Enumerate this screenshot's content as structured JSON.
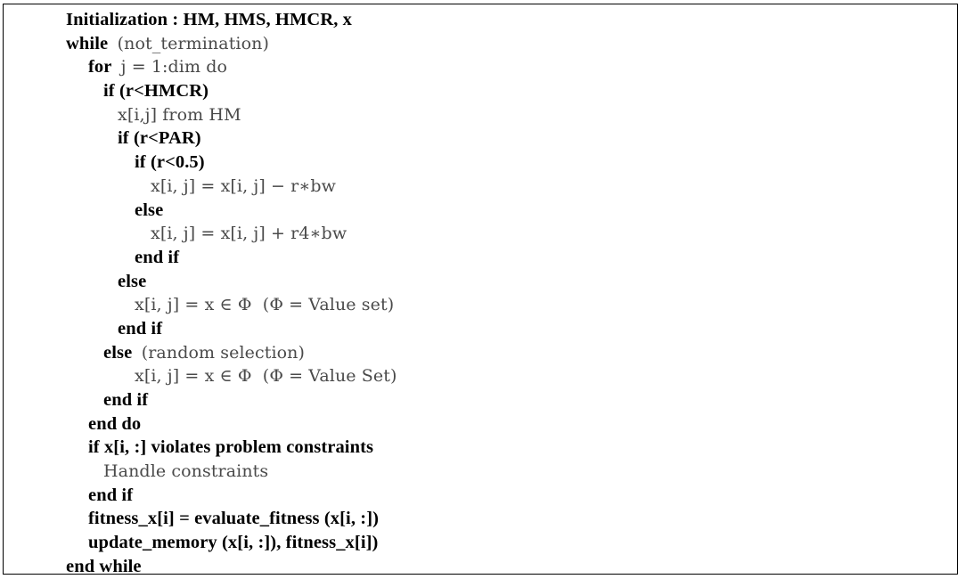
{
  "figure": {
    "kind": "pseudocode-listing",
    "border_color": "#000000",
    "background_color": "#ffffff",
    "text_color": "#000000",
    "light_text_color": "#4a4a4a",
    "line_count": 24
  },
  "code": {
    "lines": [
      {
        "indent": 0,
        "segments": [
          {
            "text": "Initialization : HM, HMS, HMCR, x",
            "weight": "strong"
          }
        ]
      },
      {
        "indent": 0,
        "segments": [
          {
            "text": "while  ",
            "weight": "strong"
          },
          {
            "text": "(not_termination)",
            "weight": "light"
          }
        ]
      },
      {
        "indent": 1,
        "segments": [
          {
            "text": "for  ",
            "weight": "strong"
          },
          {
            "text": "j = 1:dim do",
            "weight": "light"
          }
        ]
      },
      {
        "indent": 2,
        "segments": [
          {
            "text": "if (r<HMCR)",
            "weight": "strong"
          }
        ]
      },
      {
        "indent": 3,
        "segments": [
          {
            "text": "x[i,j] from HM",
            "weight": "light"
          }
        ]
      },
      {
        "indent": 3,
        "segments": [
          {
            "text": "if (r<PAR)",
            "weight": "strong"
          }
        ]
      },
      {
        "indent": 4,
        "segments": [
          {
            "text": "if (r<0.5)",
            "weight": "strong"
          }
        ]
      },
      {
        "indent": 5,
        "segments": [
          {
            "text": "x[i, j] = x[i, j] − r∗bw",
            "weight": "light"
          }
        ]
      },
      {
        "indent": 4,
        "segments": [
          {
            "text": "else",
            "weight": "strong"
          }
        ]
      },
      {
        "indent": 5,
        "segments": [
          {
            "text": "x[i, j] = x[i, j] + r4∗bw",
            "weight": "light"
          }
        ]
      },
      {
        "indent": 4,
        "segments": [
          {
            "text": "end if",
            "weight": "strong"
          }
        ]
      },
      {
        "indent": 3,
        "segments": [
          {
            "text": "else",
            "weight": "strong"
          }
        ]
      },
      {
        "indent": 4,
        "segments": [
          {
            "text": "x[i, j] = x ∈ Φ  (Φ = Value set)",
            "weight": "light"
          }
        ]
      },
      {
        "indent": 3,
        "segments": [
          {
            "text": "end if",
            "weight": "strong"
          }
        ]
      },
      {
        "indent": 2,
        "segments": [
          {
            "text": "else  ",
            "weight": "strong"
          },
          {
            "text": "(random selection)",
            "weight": "light"
          }
        ]
      },
      {
        "indent": 4,
        "segments": [
          {
            "text": "x[i, j] = x ∈ Φ  (Φ = Value Set)",
            "weight": "light"
          }
        ]
      },
      {
        "indent": 2,
        "segments": [
          {
            "text": "end if",
            "weight": "strong"
          }
        ]
      },
      {
        "indent": 1,
        "segments": [
          {
            "text": "end do",
            "weight": "strong"
          }
        ]
      },
      {
        "indent": 1,
        "segments": [
          {
            "text": "if x[i, :] violates problem constraints",
            "weight": "strong"
          }
        ]
      },
      {
        "indent": 2,
        "segments": [
          {
            "text": "Handle constraints",
            "weight": "light"
          }
        ]
      },
      {
        "indent": 1,
        "segments": [
          {
            "text": "end if",
            "weight": "strong"
          }
        ]
      },
      {
        "indent": 1,
        "segments": [
          {
            "text": "fitness_x[i] = evaluate_fitness (x[i, :])",
            "weight": "strong"
          }
        ]
      },
      {
        "indent": 1,
        "segments": [
          {
            "text": "update_memory (x[i, :]), fitness_x[i])",
            "weight": "strong"
          }
        ]
      },
      {
        "indent": 0,
        "segments": [
          {
            "text": "end while",
            "weight": "strong"
          }
        ]
      }
    ]
  }
}
